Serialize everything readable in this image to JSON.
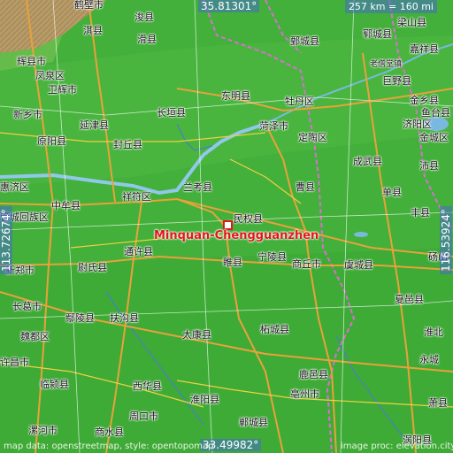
{
  "map": {
    "place_label": "Minquan-Chengguanzhen",
    "coords": {
      "top_lat": "35.81301°",
      "bottom_lat": "33.49982°",
      "left_lon": "113.72674°",
      "right_lon": "116.53924°"
    },
    "scale": "257 km = 160 mi",
    "attribution_left": "map data: openstreetmap, style: opentopomap",
    "attribution_right": "image proc: elevation.city",
    "cities": [
      {
        "id": "hebi",
        "label": "鹤壁市"
      },
      {
        "id": "junxian",
        "label": "浚县"
      },
      {
        "id": "qixian",
        "label": "淇县"
      },
      {
        "id": "huaxian",
        "label": "滑县"
      },
      {
        "id": "huixian",
        "label": "辉县市"
      },
      {
        "id": "fengqiu0",
        "label": "凤泉区"
      },
      {
        "id": "weihui",
        "label": "卫辉市"
      },
      {
        "id": "xinxiang",
        "label": "新乡市"
      },
      {
        "id": "yanjin",
        "label": "延津县"
      },
      {
        "id": "changyuan",
        "label": "长垣县"
      },
      {
        "id": "dongming",
        "label": "东明县"
      },
      {
        "id": "mudan",
        "label": "牡丹区"
      },
      {
        "id": "heze",
        "label": "菏泽市"
      },
      {
        "id": "dingtao",
        "label": "定陶区"
      },
      {
        "id": "yuanyang",
        "label": "原阳县"
      },
      {
        "id": "fengqiu",
        "label": "封丘县"
      },
      {
        "id": "chengwu",
        "label": "成武县"
      },
      {
        "id": "caoxian",
        "label": "曹县"
      },
      {
        "id": "lankao",
        "label": "兰考县"
      },
      {
        "id": "xiangfu",
        "label": "祥符区"
      },
      {
        "id": "zhongmou",
        "label": "中牟县"
      },
      {
        "id": "minquan",
        "label": "民权县"
      },
      {
        "id": "danxian",
        "label": "单县"
      },
      {
        "id": "huiji",
        "label": "惠济区"
      },
      {
        "id": "guancheng",
        "label": "管城回族区"
      },
      {
        "id": "tongxu",
        "label": "通许县"
      },
      {
        "id": "suixian",
        "label": "睢县"
      },
      {
        "id": "ningling",
        "label": "宁陵县"
      },
      {
        "id": "shangqiu",
        "label": "商丘市"
      },
      {
        "id": "yucheng",
        "label": "虞城县"
      },
      {
        "id": "dangshan",
        "label": "砀山"
      },
      {
        "id": "xinzheng",
        "label": "新郑市"
      },
      {
        "id": "weishi",
        "label": "尉氏县"
      },
      {
        "id": "xiayi",
        "label": "夏邑县"
      },
      {
        "id": "changge",
        "label": "长葛市"
      },
      {
        "id": "yanling",
        "label": "鄢陵县"
      },
      {
        "id": "fugou",
        "label": "扶沟县"
      },
      {
        "id": "zhecheng",
        "label": "柘城县"
      },
      {
        "id": "weidu",
        "label": "魏都区"
      },
      {
        "id": "taikang",
        "label": "太康县"
      },
      {
        "id": "xuchang",
        "label": "许昌市"
      },
      {
        "id": "linying",
        "label": "临颍县"
      },
      {
        "id": "luyi",
        "label": "鹿邑县"
      },
      {
        "id": "yongcheng",
        "label": "永城"
      },
      {
        "id": "xihua",
        "label": "西华县"
      },
      {
        "id": "huaiyang",
        "label": "淮阳县"
      },
      {
        "id": "bozhou",
        "label": "亳州市"
      },
      {
        "id": "dancheng",
        "label": "郸城县"
      },
      {
        "id": "zhoukou",
        "label": "周口市"
      },
      {
        "id": "luohe",
        "label": "漯河市"
      },
      {
        "id": "shangshui",
        "label": "商水县"
      },
      {
        "id": "guoyang",
        "label": "涡阳县"
      },
      {
        "id": "juancheng",
        "label": "鄄城县"
      },
      {
        "id": "yuncheng",
        "label": "郓城县"
      },
      {
        "id": "liangshan",
        "label": "梁山县"
      },
      {
        "id": "jiaxiang",
        "label": "嘉祥县"
      },
      {
        "id": "juye",
        "label": "巨野县"
      },
      {
        "id": "laoyi",
        "label": "老僧堂镇"
      },
      {
        "id": "yutai",
        "label": "鱼台县"
      },
      {
        "id": "jinxiang",
        "label": "金乡县"
      },
      {
        "id": "fengxian",
        "label": "丰县"
      },
      {
        "id": "peixian",
        "label": "沛县"
      },
      {
        "id": "jiyang",
        "label": "济阳区"
      },
      {
        "id": "jincheng",
        "label": "金城区"
      },
      {
        "id": "huaibei",
        "label": "淮北"
      },
      {
        "id": "xiao",
        "label": "萧县"
      }
    ]
  }
}
